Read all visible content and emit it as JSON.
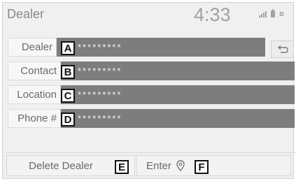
{
  "header": {
    "title": "Dealer",
    "time": "4:33",
    "status_icons": [
      "signal-icon",
      "battery-icon",
      "bluetooth-icon"
    ]
  },
  "fields": [
    {
      "label": "Dealer",
      "callout": "A",
      "value": "*********"
    },
    {
      "label": "Contact",
      "callout": "B",
      "value": "*********"
    },
    {
      "label": "Location",
      "callout": "C",
      "value": "*********"
    },
    {
      "label": "Phone #",
      "callout": "D",
      "value": "*********"
    }
  ],
  "buttons": {
    "back_icon": "back-arrow-icon",
    "delete_label": "Delete Dealer",
    "delete_callout": "E",
    "enter_label": "Enter",
    "enter_icon": "map-pin-icon",
    "enter_callout": "F"
  },
  "colors": {
    "value_bar": "#7d7d7d",
    "screen_bg": "#f0f0f0",
    "label_text": "#6a6a6a"
  }
}
